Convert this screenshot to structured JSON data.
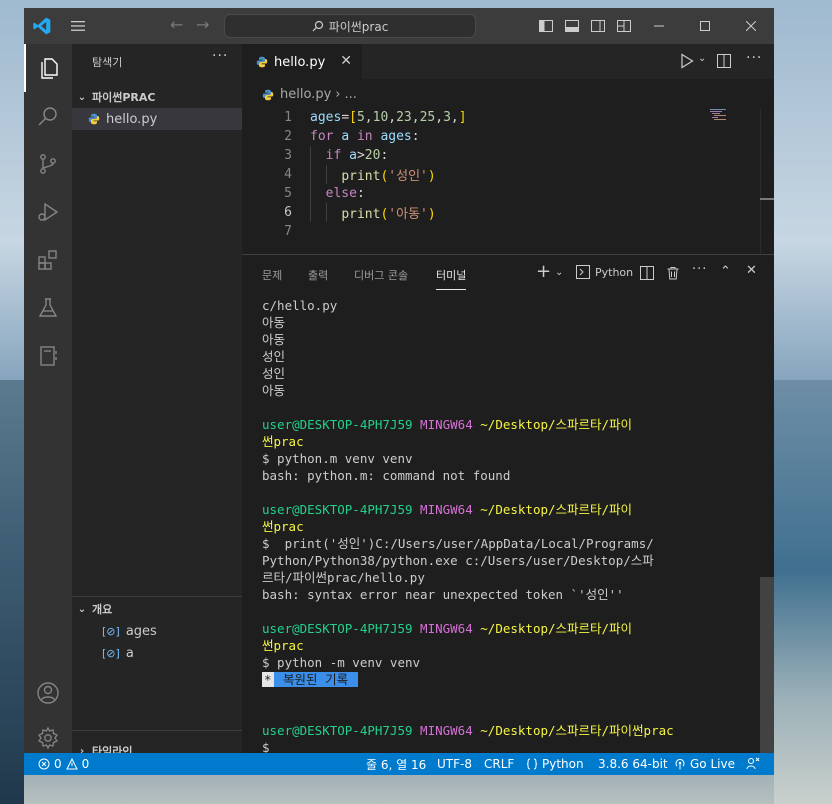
{
  "window": {
    "search_text": "파이썬prac"
  },
  "sidebar": {
    "title": "탐색기",
    "more": "···",
    "folder": "파이썬PRAC",
    "file": "hello.py",
    "outline_title": "개요",
    "outline_items": [
      "ages",
      "a"
    ],
    "timeline_title": "타임라인"
  },
  "editor": {
    "tab": "hello.py",
    "breadcrumb_file": "hello.py",
    "breadcrumb_more": "...",
    "current_line": 6,
    "lines": [
      {
        "n": "1",
        "text": "ages=[5,10,23,25,3,]"
      },
      {
        "n": "2",
        "text": "for a in ages:"
      },
      {
        "n": "3",
        "text": "  if a>20:"
      },
      {
        "n": "4",
        "text": "    print('성인')"
      },
      {
        "n": "5",
        "text": "  else:"
      },
      {
        "n": "6",
        "text": "    print('아동')"
      },
      {
        "n": "7",
        "text": ""
      }
    ]
  },
  "panel": {
    "tabs": [
      "문제",
      "출력",
      "디버그 콘솔",
      "터미널"
    ],
    "active_tab": "터미널",
    "terminal_profile": "Python"
  },
  "terminal": {
    "output_top": [
      "c/hello.py",
      "아동",
      "아동",
      "성인",
      "성인",
      "아동"
    ],
    "user": "user@DESKTOP-4PH7J59",
    "env": "MINGW64",
    "path_part1": "~/Desktop/스파르타/파이",
    "path_part2": "썬prac",
    "path_full": "~/Desktop/스파르타/파이썬prac",
    "cmd1": "$ python.m venv venv",
    "err1": "bash: python.m: command not found",
    "cmd2_lines": [
      "$  print('성인')C:/Users/user/AppData/Local/Programs/",
      "Python/Python38/python.exe c:/Users/user/Desktop/스파",
      "르타/파이썬prac/hello.py"
    ],
    "err2": "bash: syntax error near unexpected token `'성인''",
    "cmd3": "$ python -m venv venv",
    "history_star": "*",
    "history_label": " 복원된 기록 ",
    "prompt": "$"
  },
  "statusbar": {
    "errors": "0",
    "warnings": "0",
    "position": "줄 6, 열 16",
    "encoding": "UTF-8",
    "eol": "CRLF",
    "language": "Python",
    "interpreter": "3.8.6 64-bit",
    "golive": "Go Live"
  },
  "colors": {
    "accent": "#007acc",
    "titlebar": "#3c3c3c",
    "editor_bg": "#1e1e1e"
  }
}
